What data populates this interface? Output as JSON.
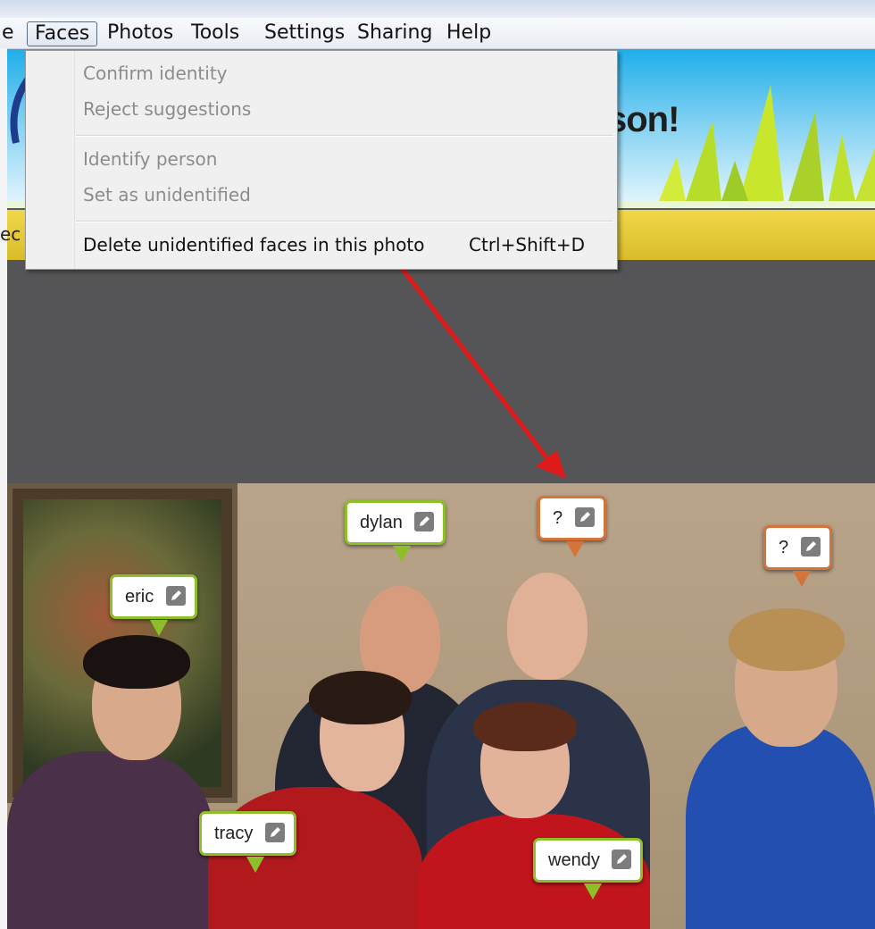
{
  "menubar": {
    "items": [
      {
        "label": "e"
      },
      {
        "label": "Faces"
      },
      {
        "label": "Photos"
      },
      {
        "label": "Tools"
      },
      {
        "label": "Settings"
      },
      {
        "label": "Sharing"
      },
      {
        "label": "Help"
      }
    ]
  },
  "banner": {
    "text_fragment": "son!"
  },
  "yellow_bar": {
    "text_fragment": "ec"
  },
  "faces_menu": {
    "items": [
      {
        "label": "Confirm identity",
        "enabled": false
      },
      {
        "label": "Reject suggestions",
        "enabled": false
      },
      {
        "label": "Identify person",
        "enabled": false
      },
      {
        "label": "Set as unidentified",
        "enabled": false
      },
      {
        "label": "Delete unidentified faces in this photo",
        "enabled": true,
        "shortcut": "Ctrl+Shift+D"
      }
    ]
  },
  "face_tags": [
    {
      "label": "dylan",
      "status": "identified"
    },
    {
      "label": "?",
      "status": "unidentified"
    },
    {
      "label": "?",
      "status": "unidentified"
    },
    {
      "label": "eric",
      "status": "identified"
    },
    {
      "label": "tracy",
      "status": "identified"
    },
    {
      "label": "wendy",
      "status": "identified"
    }
  ],
  "colors": {
    "identified_tag_border": "#8cbf2a",
    "unidentified_tag_border": "#d4733a",
    "annotation_arrow": "#e01b1b"
  }
}
